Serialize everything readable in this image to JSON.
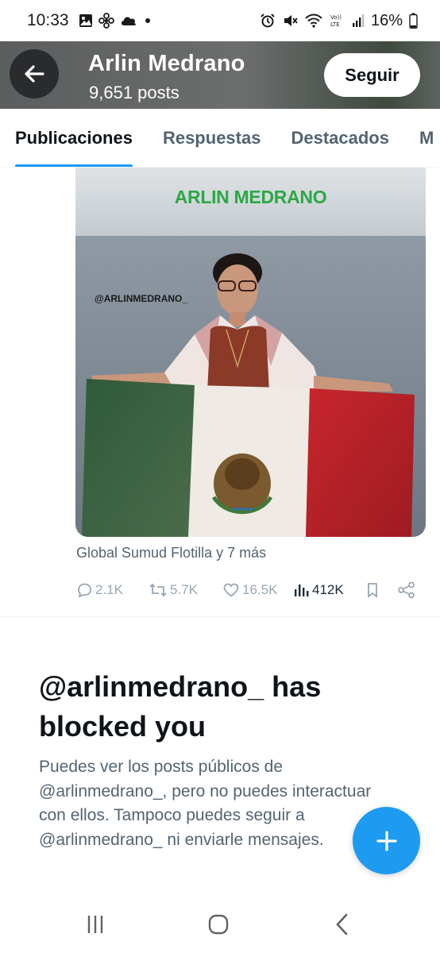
{
  "status_bar": {
    "time": "10:33",
    "battery_text": "16%",
    "left_icons": [
      "gallery-icon",
      "fan-icon",
      "cloud-icon",
      "dot-icon"
    ],
    "right_icons": [
      "alarm-icon",
      "mute-icon",
      "wifi-icon",
      "volte-icon",
      "signal-icon",
      "battery-icon"
    ]
  },
  "header": {
    "title": "Arlin Medrano",
    "subtitle": "9,651 posts",
    "follow_label": "Seguir",
    "back_icon": "arrow-left-icon"
  },
  "tabs": [
    {
      "label": "Publicaciones",
      "active": true
    },
    {
      "label": "Respuestas",
      "active": false
    },
    {
      "label": "Destacados",
      "active": false
    },
    {
      "label": "M",
      "active": false
    }
  ],
  "post": {
    "media_title": "ARLIN MEDRANO",
    "media_handle": "@ARLINMEDRANO_",
    "meta": "Global Sumud Flotilla y 7 más",
    "actions": {
      "replies": "2.1K",
      "reposts": "5.7K",
      "likes": "16.5K",
      "views": "412K"
    }
  },
  "blocked": {
    "title": "@arlinmedrano_ has blocked you",
    "body": "Puedes ver los posts públicos de @arlinmedrano_, pero no puedes interactuar con ellos. Tampoco puedes seguir a @arlinmedrano_ ni enviarle mensajes."
  },
  "fab_icon": "plus-icon",
  "colors": {
    "accent": "#1d9bf0",
    "muted_text": "#536471",
    "green_title": "#2aa845"
  }
}
